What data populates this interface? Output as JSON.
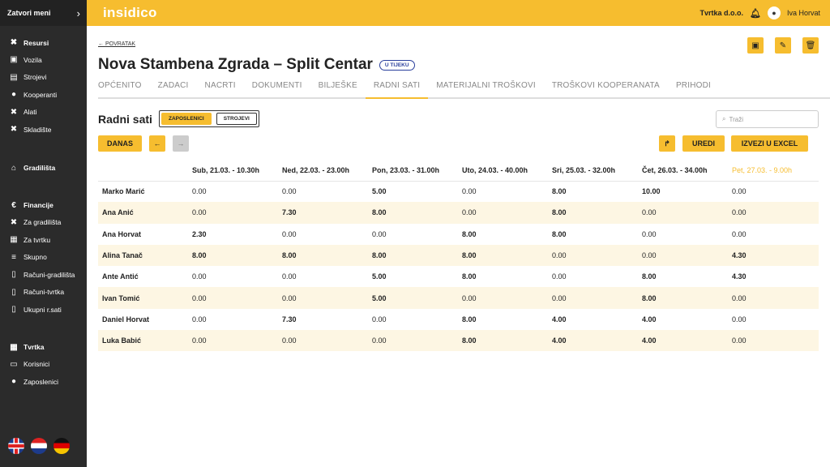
{
  "sidebar": {
    "toggle_label": "Zatvori meni",
    "resursi": {
      "title": "Resursi",
      "items": [
        "Vozila",
        "Strojevi",
        "Kooperanti",
        "Alati",
        "Skladište"
      ]
    },
    "gradilista": {
      "title": "Gradilišta"
    },
    "financije": {
      "title": "Financije",
      "items": [
        "Za gradilišta",
        "Za tvrtku",
        "Skupno",
        "Računi-gradilišta",
        "Računi-tvrtka",
        "Ukupni r.sati"
      ]
    },
    "tvrtka": {
      "title": "Tvrtka",
      "items": [
        "Korisnici",
        "Zaposlenici"
      ]
    },
    "languages": [
      "en",
      "hr",
      "de"
    ]
  },
  "topbar": {
    "logo": "insidico",
    "company": "Tvrtka d.o.o.",
    "user": "Iva Horvat",
    "brand_color": "#f6bd2f"
  },
  "page": {
    "back_label": "POVRATAK",
    "title": "Nova Stambena Zgrada – Split Centar",
    "status": "U TIJEKU",
    "tabs": [
      "OPĆENITO",
      "ZADACI",
      "NACRTI",
      "DOKUMENTI",
      "BILJEŠKE",
      "RADNI SATI",
      "MATERIJALNI TROŠKOVI",
      "TROŠKOVI KOOPERANATA",
      "PRIHODI"
    ],
    "active_tab": "RADNI SATI"
  },
  "work_hours": {
    "title": "Radni sati",
    "toggle": [
      "ZAPOSLENICI",
      "STROJEVI"
    ],
    "toggle_selected": "ZAPOSLENICI",
    "search_placeholder": "Traži",
    "today_label": "DANAS",
    "edit_label": "UREDI",
    "export_label": "IZVEZI U EXCEL",
    "columns": [
      "Sub, 21.03. - 10.30h",
      "Ned, 22.03. - 23.00h",
      "Pon, 23.03. - 31.00h",
      "Uto, 24.03. - 40.00h",
      "Sri, 25.03. - 32.00h",
      "Čet, 26.03. - 34.00h",
      "Pet, 27.03. - 9.00h"
    ],
    "rows": [
      {
        "name": "Marko Marić",
        "values": [
          "0.00",
          "0.00",
          "5.00",
          "0.00",
          "8.00",
          "10.00",
          "0.00"
        ]
      },
      {
        "name": "Ana Anić",
        "values": [
          "0.00",
          "7.30",
          "8.00",
          "0.00",
          "8.00",
          "0.00",
          "0.00"
        ]
      },
      {
        "name": "Ana Horvat",
        "values": [
          "2.30",
          "0.00",
          "0.00",
          "8.00",
          "8.00",
          "0.00",
          "0.00"
        ]
      },
      {
        "name": "Alina Tanač",
        "values": [
          "8.00",
          "8.00",
          "8.00",
          "8.00",
          "0.00",
          "0.00",
          "4.30"
        ]
      },
      {
        "name": "Ante Antić",
        "values": [
          "0.00",
          "0.00",
          "5.00",
          "8.00",
          "0.00",
          "8.00",
          "4.30"
        ]
      },
      {
        "name": "Ivan Tomić",
        "values": [
          "0.00",
          "0.00",
          "5.00",
          "0.00",
          "0.00",
          "8.00",
          "0.00"
        ]
      },
      {
        "name": "Daniel Horvat",
        "values": [
          "0.00",
          "7.30",
          "0.00",
          "8.00",
          "4.00",
          "4.00",
          "0.00"
        ]
      },
      {
        "name": "Luka Babić",
        "values": [
          "0.00",
          "0.00",
          "0.00",
          "8.00",
          "4.00",
          "4.00",
          "0.00"
        ]
      }
    ]
  }
}
